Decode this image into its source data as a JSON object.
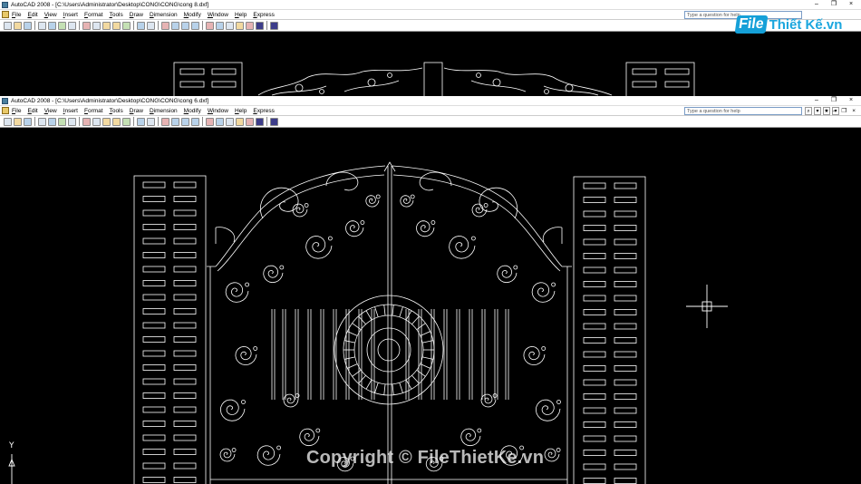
{
  "back_window": {
    "title": "AutoCAD 2008 - [C:\\Users\\Administrator\\Desktop\\CONG\\CONG\\cong 8.dxf]",
    "help_placeholder": "Type a question for help"
  },
  "front_window": {
    "title": "AutoCAD 2008 - [C:\\Users\\Administrator\\Desktop\\CONG\\CONG\\cong 6.dxf]",
    "help_placeholder": "Type a question for help"
  },
  "menu": [
    "File",
    "Edit",
    "View",
    "Insert",
    "Format",
    "Tools",
    "Draw",
    "Dimension",
    "Modify",
    "Window",
    "Help",
    "Express"
  ],
  "window_controls": {
    "minimize": "–",
    "restore": "❐",
    "close": "×"
  },
  "help_tools": [
    "⌕",
    "▾",
    "★",
    "▾"
  ],
  "logo": {
    "mark": "File",
    "text": "Thiết Kế.vn"
  },
  "watermark": "Copyright © FileThietKe.vn",
  "ucs": {
    "y_label": "Y"
  },
  "colors": {
    "background": "#000000",
    "lines": "#ffffff",
    "logo_blue": "#15a0d8",
    "menubar": "#ffffff"
  },
  "icons": [
    "new-icon",
    "open-icon",
    "save-icon",
    "print-icon",
    "preview-icon",
    "publish-icon",
    "cut-icon",
    "copy-icon",
    "paste-icon",
    "match-properties-icon",
    "undo-icon",
    "redo-icon",
    "pan-icon",
    "zoom-realtime-icon",
    "zoom-window-icon",
    "zoom-previous-icon",
    "properties-icon",
    "design-center-icon",
    "tool-palettes-icon",
    "sheet-set-icon",
    "markup-icon",
    "calculator-icon",
    "help-icon"
  ]
}
